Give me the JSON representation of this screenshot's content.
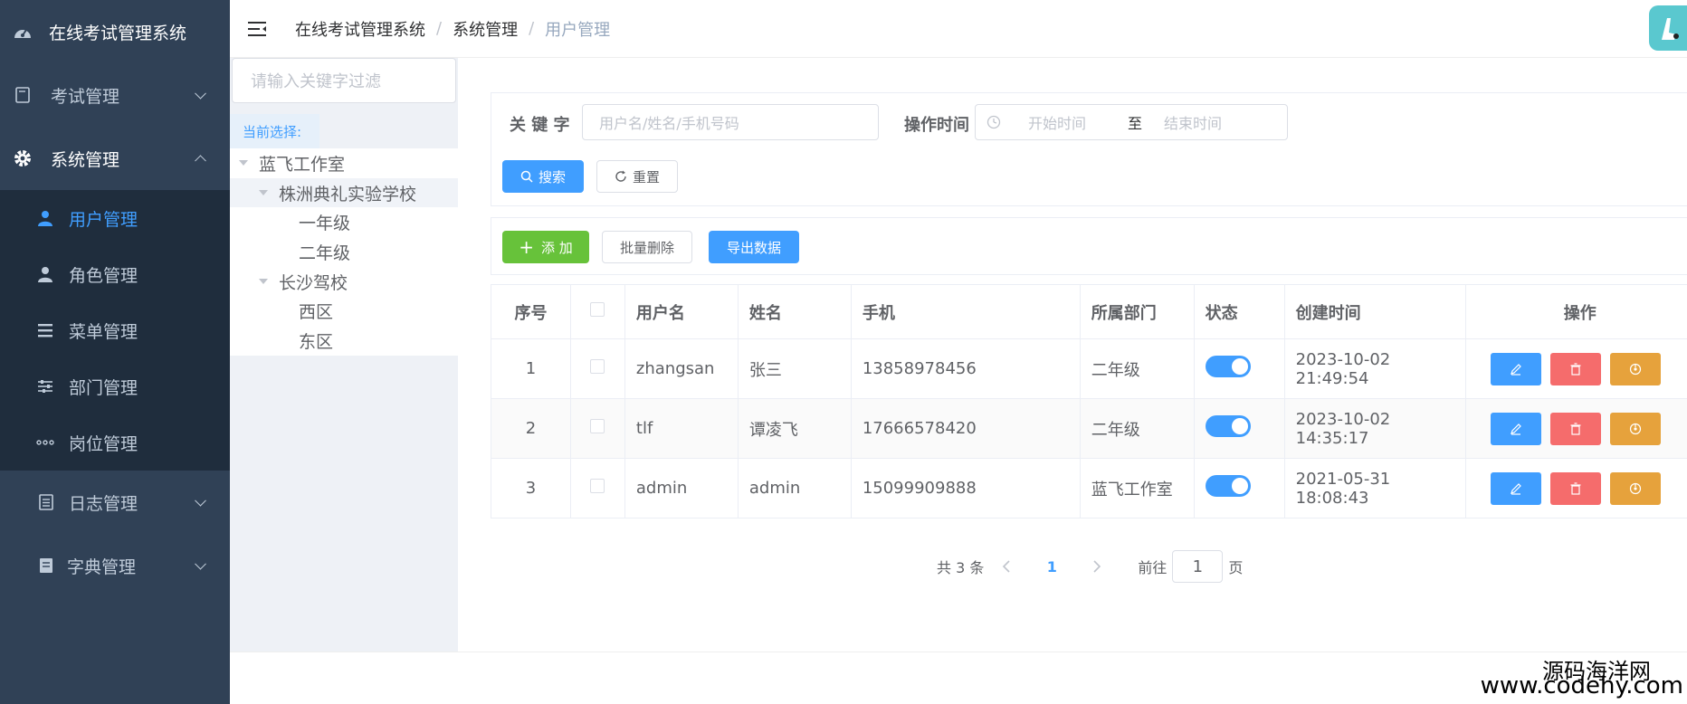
{
  "sidebar": {
    "title": "在线考试管理系统",
    "menu": {
      "exam": "考试管理",
      "system": "系统管理",
      "user": "用户管理",
      "role": "角色管理",
      "menu_mgmt": "菜单管理",
      "dept": "部门管理",
      "post": "岗位管理",
      "log": "日志管理",
      "dict": "字典管理"
    }
  },
  "header": {
    "breadcrumb": [
      "在线考试管理系统",
      "系统管理",
      "用户管理"
    ],
    "sep": "/"
  },
  "tree": {
    "filter_placeholder": "请输入关键字过滤",
    "current_label": "当前选择:",
    "nodes": [
      "蓝飞工作室",
      "株洲典礼实验学校",
      "一年级",
      "二年级",
      "长沙驾校",
      "西区",
      "东区"
    ]
  },
  "search": {
    "keyword_label": "关 键 字",
    "keyword_placeholder": "用户名/姓名/手机号码",
    "time_label": "操作时间",
    "start_placeholder": "开始时间",
    "range_sep": "至",
    "end_placeholder": "结束时间",
    "search_btn": "搜索",
    "reset_btn": "重置"
  },
  "toolbar": {
    "add_btn": "添 加",
    "batch_delete_btn": "批量删除",
    "export_btn": "导出数据"
  },
  "table": {
    "headers": [
      "序号",
      "",
      "用户名",
      "姓名",
      "手机",
      "所属部门",
      "状态",
      "创建时间",
      "操作"
    ],
    "rows": [
      {
        "idx": "1",
        "username": "zhangsan",
        "name": "张三",
        "phone": "13858978456",
        "dept": "二年级",
        "enabled": true,
        "created": "2023-10-02 21:49:54"
      },
      {
        "idx": "2",
        "username": "tlf",
        "name": "谭凌飞",
        "phone": "17666578420",
        "dept": "二年级",
        "enabled": true,
        "created": "2023-10-02 14:35:17"
      },
      {
        "idx": "3",
        "username": "admin",
        "name": "admin",
        "phone": "15099909888",
        "dept": "蓝飞工作室",
        "enabled": true,
        "created": "2021-05-31 18:08:43"
      }
    ]
  },
  "pagination": {
    "total_text": "共 3 条",
    "current_page": "1",
    "goto_label": "前往",
    "goto_value": "1",
    "page_suffix": "页"
  },
  "watermark": {
    "line1": "源码海洋网",
    "line2": "www.codehy.com"
  },
  "colors": {
    "sidebar_bg": "#304156",
    "sidebar_sub_bg": "#1f2d3d",
    "primary": "#409eff",
    "success": "#67c23a",
    "danger": "#f56c6c",
    "warning": "#e6a23c"
  }
}
